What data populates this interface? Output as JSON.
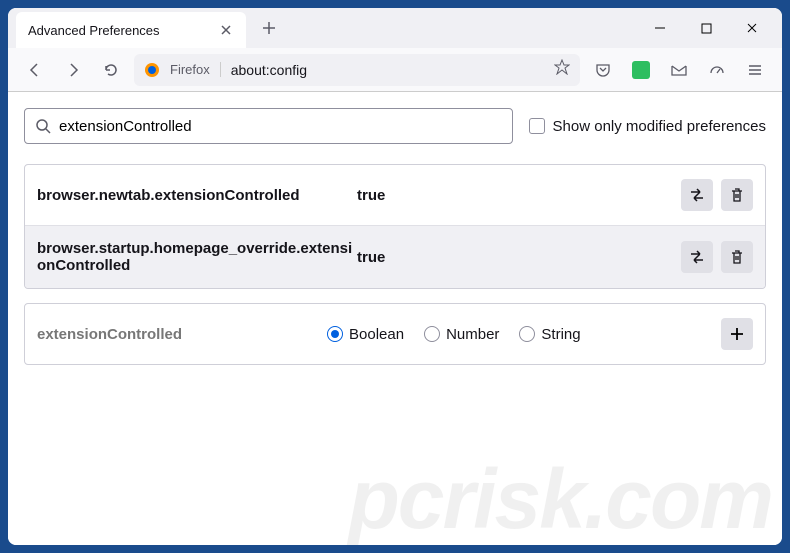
{
  "tab": {
    "title": "Advanced Preferences"
  },
  "url": {
    "brand": "Firefox",
    "address": "about:config"
  },
  "search": {
    "value": "extensionControlled",
    "checkbox_label": "Show only modified preferences"
  },
  "prefs": [
    {
      "name": "browser.newtab.extensionControlled",
      "value": "true"
    },
    {
      "name": "browser.startup.homepage_override.extensionControlled",
      "value": "true"
    }
  ],
  "new_pref": {
    "name": "extensionControlled",
    "types": [
      {
        "label": "Boolean",
        "selected": true
      },
      {
        "label": "Number",
        "selected": false
      },
      {
        "label": "String",
        "selected": false
      }
    ]
  },
  "watermark": "pcrisk.com"
}
